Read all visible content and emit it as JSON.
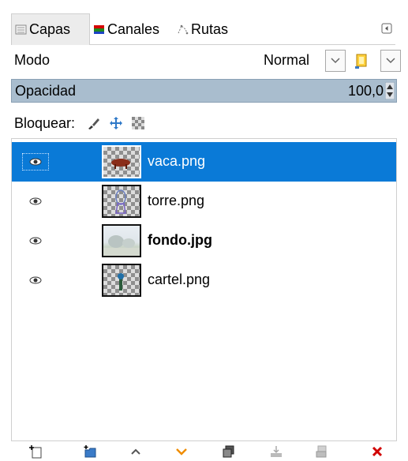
{
  "tabs": [
    {
      "label": "Capas",
      "icon": "layers-icon"
    },
    {
      "label": "Canales",
      "icon": "channels-icon"
    },
    {
      "label": "Rutas",
      "icon": "paths-icon"
    }
  ],
  "mode": {
    "label": "Modo",
    "value": "Normal"
  },
  "opacity": {
    "label": "Opacidad",
    "value": "100,0"
  },
  "lock": {
    "label": "Bloquear:"
  },
  "layers": [
    {
      "name": "vaca.png",
      "selected": true
    },
    {
      "name": "torre.png",
      "selected": false
    },
    {
      "name": "fondo.jpg",
      "selected": false
    },
    {
      "name": "cartel.png",
      "selected": false
    }
  ],
  "colors": {
    "selection": "#0a7ad7",
    "opacity_bar": "#a9bdce",
    "delete": "#d10000",
    "orange": "#f08c00"
  }
}
